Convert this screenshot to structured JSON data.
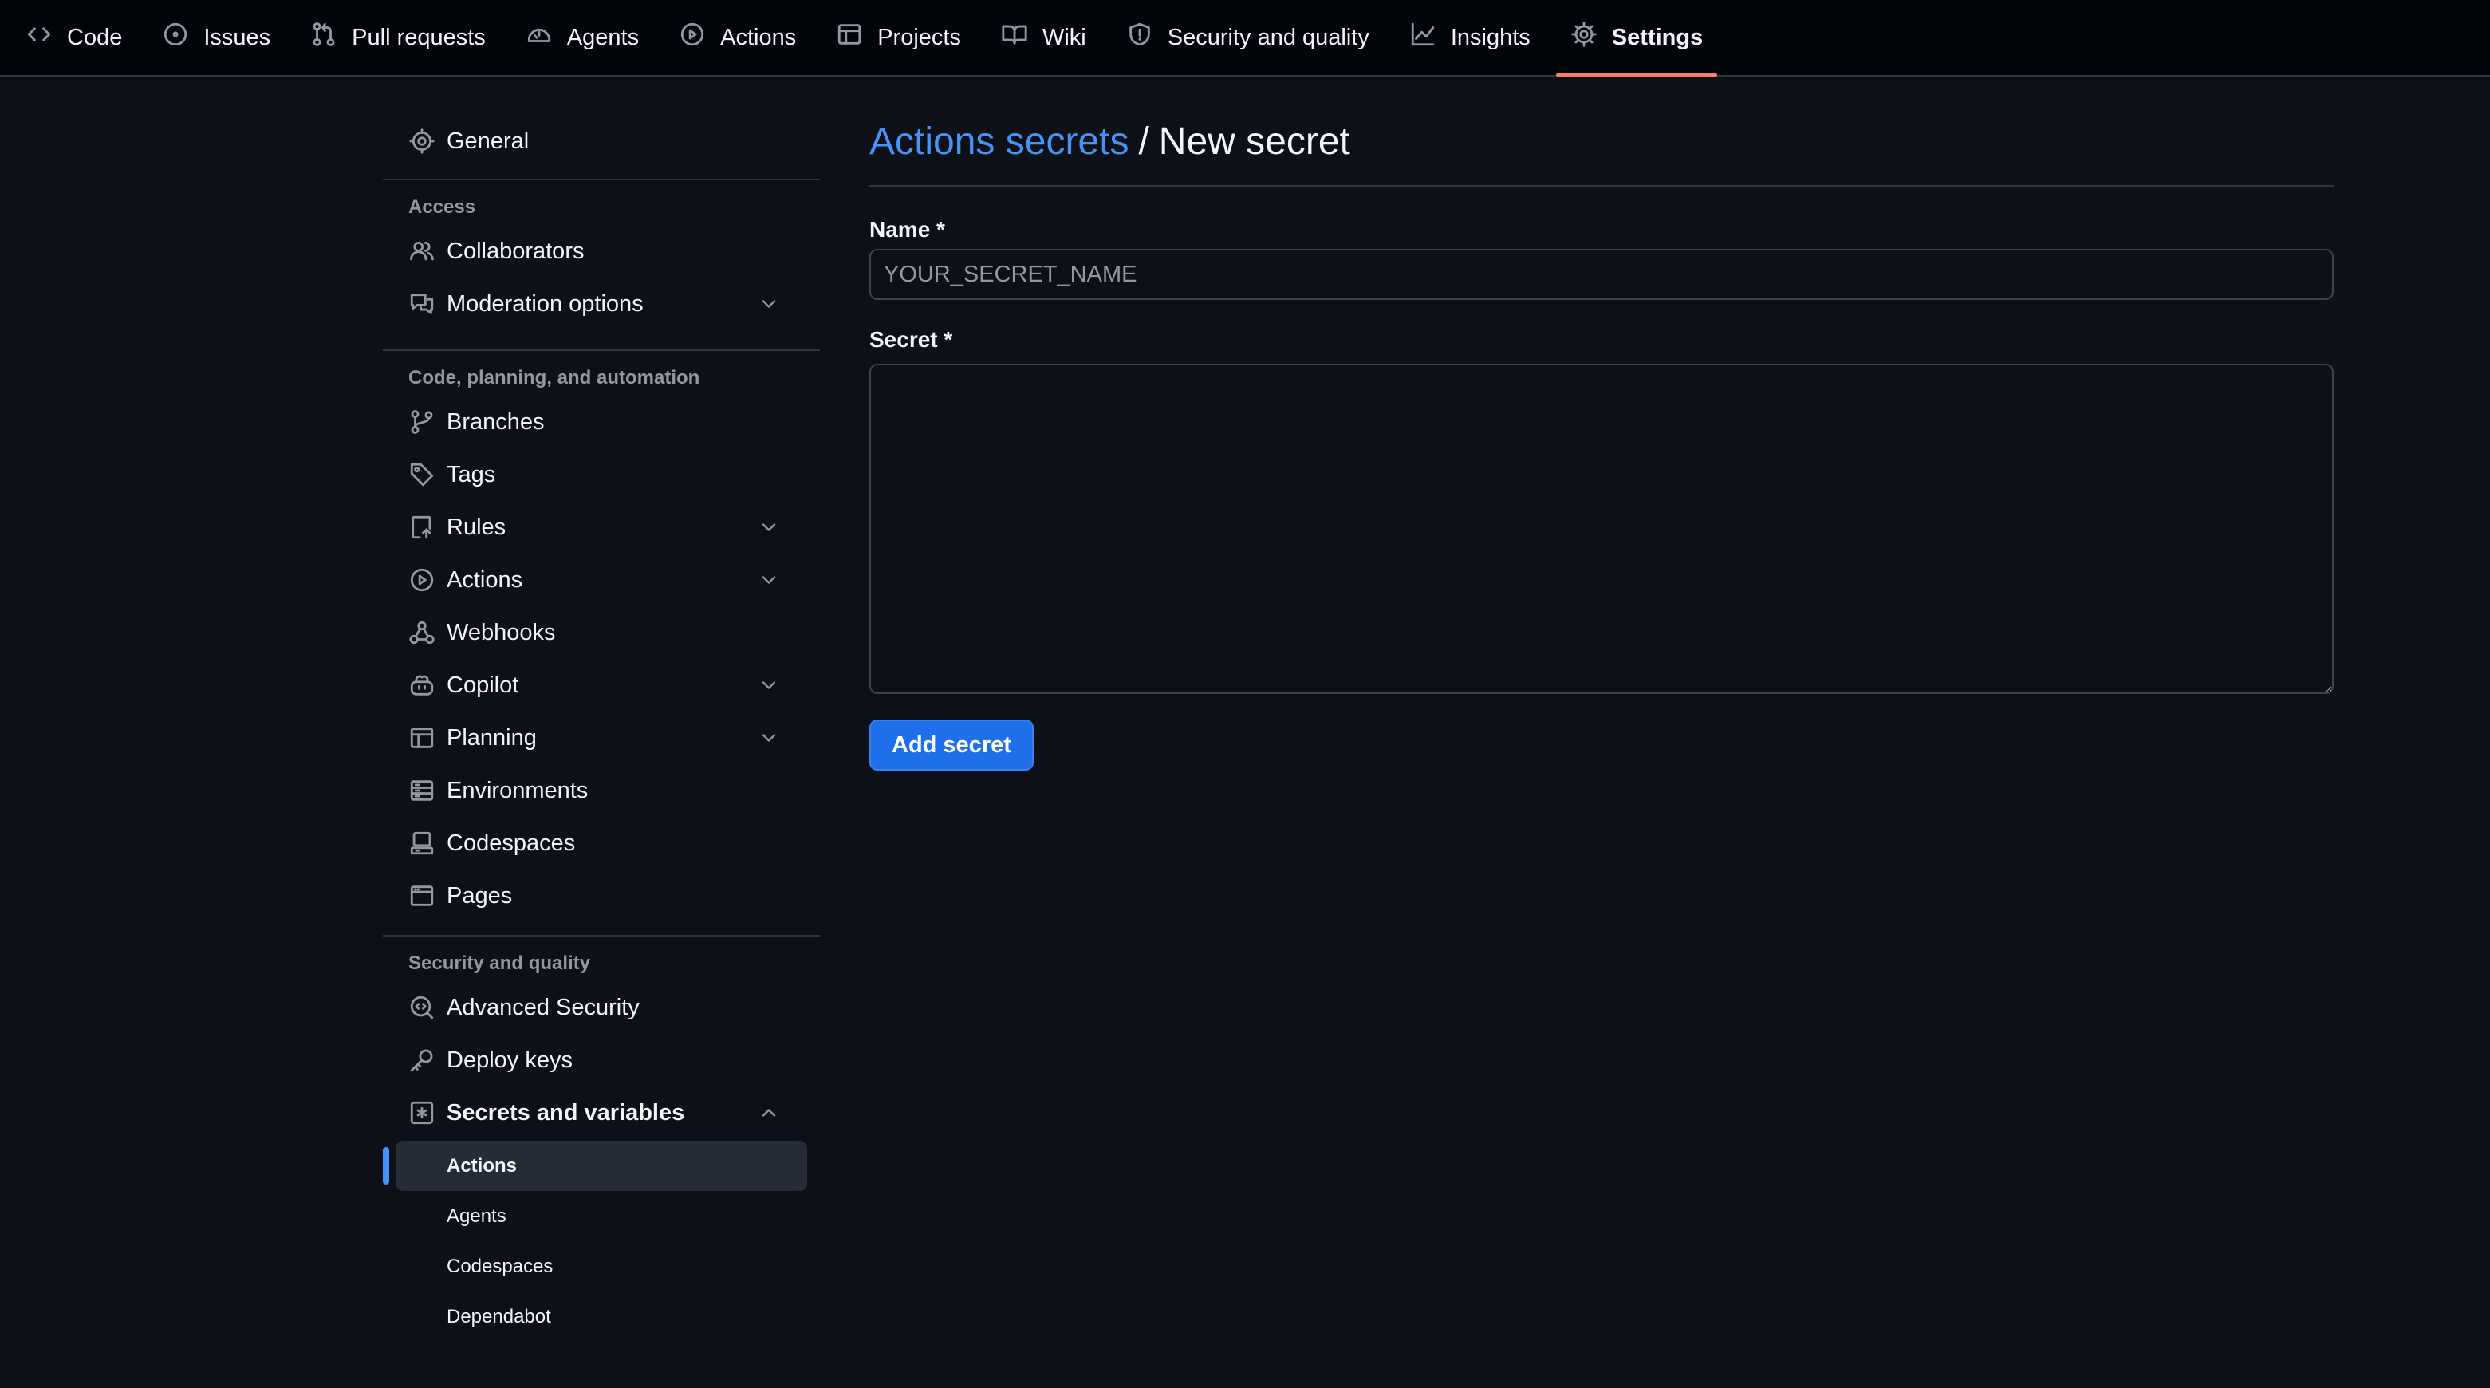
{
  "nav": {
    "tabs": [
      {
        "label": "Code",
        "icon": "code-icon"
      },
      {
        "label": "Issues",
        "icon": "issue-icon"
      },
      {
        "label": "Pull requests",
        "icon": "pull-request-icon"
      },
      {
        "label": "Agents",
        "icon": "agent-icon"
      },
      {
        "label": "Actions",
        "icon": "play-icon"
      },
      {
        "label": "Projects",
        "icon": "table-icon"
      },
      {
        "label": "Wiki",
        "icon": "book-icon"
      },
      {
        "label": "Security and quality",
        "icon": "shield-icon"
      },
      {
        "label": "Insights",
        "icon": "graph-icon"
      },
      {
        "label": "Settings",
        "icon": "gear-icon",
        "active": true
      }
    ]
  },
  "sidebar": {
    "general": "General",
    "access_heading": "Access",
    "access": [
      "Collaborators",
      "Moderation options"
    ],
    "code_heading": "Code, planning, and automation",
    "code": [
      "Branches",
      "Tags",
      "Rules",
      "Actions",
      "Webhooks",
      "Copilot",
      "Planning",
      "Environments",
      "Codespaces",
      "Pages"
    ],
    "security_heading": "Security and quality",
    "security": [
      "Advanced Security",
      "Deploy keys",
      "Secrets and variables"
    ],
    "secrets_sub": [
      "Actions",
      "Agents",
      "Codespaces",
      "Dependabot"
    ]
  },
  "main": {
    "breadcrumb_link": "Actions secrets",
    "separator": "/",
    "title": "New secret",
    "name_label": "Name *",
    "name_placeholder": "YOUR_SECRET_NAME",
    "secret_label": "Secret *",
    "submit_label": "Add secret"
  },
  "colors": {
    "background": "#0d1117",
    "nav_background": "#010409",
    "link": "#4493f8",
    "primary_button": "#1f6feb",
    "active_tab_underline": "#f78166"
  }
}
